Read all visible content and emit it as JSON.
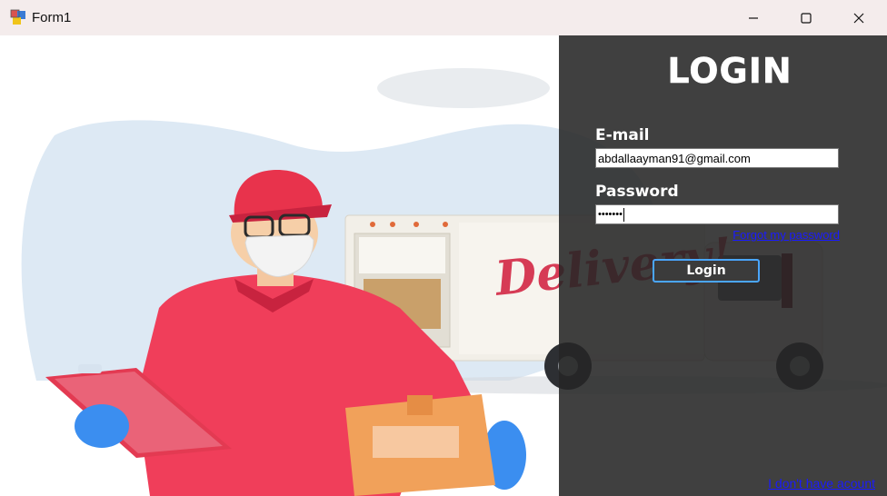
{
  "window": {
    "title": "Form1",
    "minimize_glyph": "—",
    "maximize_glyph": "☐",
    "close_glyph": "✕"
  },
  "illustration": {
    "truck_text": "Delivery!"
  },
  "login": {
    "title": "LOGIN",
    "email_label": "E-mail",
    "email_value": "abdallaayman91@gmail.com",
    "password_label": "Password",
    "password_value": "•••••••",
    "forgot_label": "Forgot my password",
    "button_label": "Login",
    "no_account_label": "I don't have acount"
  },
  "colors": {
    "overlay": "#262626",
    "link": "#1a1aff",
    "button_border": "#4aa6ff",
    "shirt": "#f03e5a",
    "cap": "#e8334c"
  }
}
